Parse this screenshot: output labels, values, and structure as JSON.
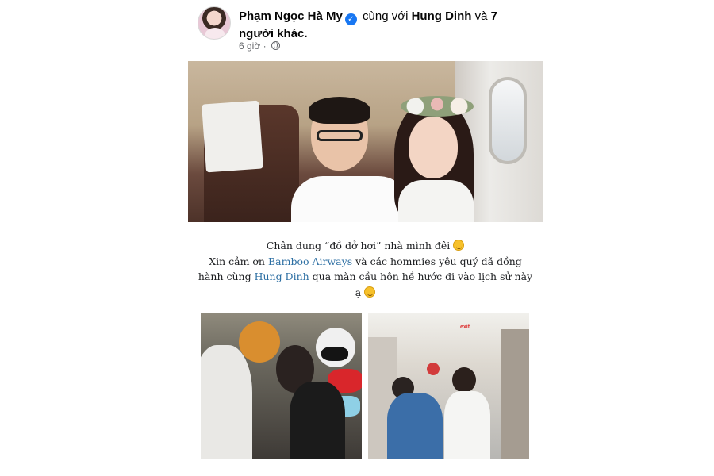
{
  "post": {
    "author": "Phạm Ngọc Hà My",
    "with_text": "cùng với",
    "tagged_person": "Hung Dinh",
    "and_text": "và",
    "others": "7 người khác.",
    "time": "6 giờ",
    "separator": "·",
    "privacy_icon": "globe-icon",
    "verified_icon": "verified-badge-icon"
  },
  "caption": {
    "line1_prefix": "Chân dung “đồ dở hơi” nhà mình đêi",
    "line2_prefix": "Xin cảm ơn",
    "brand_link": "Bamboo Airways",
    "line2_suffix": "và các hommies yêu quý đã đồng",
    "line3_prefix": "hành cùng",
    "person_link": "Hung Dinh",
    "line3_suffix": "qua màn cầu hôn hề hước đi vào lịch sử này",
    "line4_prefix": "ạ",
    "emoji": "grinning-face-emoji"
  },
  "photos": {
    "right_sign": "exit"
  },
  "colors": {
    "link": "#2d6fa3",
    "verified": "#1877f2",
    "meta": "#65676b"
  }
}
